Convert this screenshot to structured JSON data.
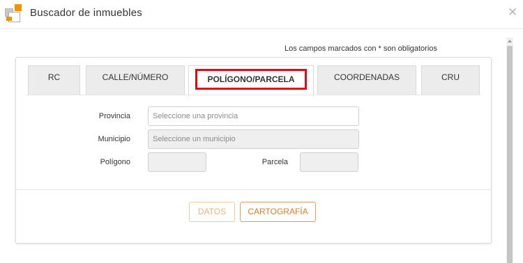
{
  "window": {
    "title": "Buscador de inmuebles",
    "close_symbol": "✕"
  },
  "form": {
    "required_note": "Los campos marcados con * son obligatorios"
  },
  "tabs": [
    {
      "label": "RC",
      "active": false
    },
    {
      "label": "CALLE/NÚMERO",
      "active": false
    },
    {
      "label": "POLÍGONO/PARCELA",
      "active": true
    },
    {
      "label": "COORDENADAS",
      "active": false
    },
    {
      "label": "CRU",
      "active": false
    }
  ],
  "fields": {
    "provincia": {
      "label": "Provincia",
      "placeholder": "Seleccione una provincia",
      "value": "",
      "enabled": true
    },
    "municipio": {
      "label": "Municipio",
      "placeholder": "Seleccione un municipio",
      "value": "",
      "enabled": false
    },
    "poligono": {
      "label": "Polígono",
      "value": "",
      "enabled": false
    },
    "parcela": {
      "label": "Parcela",
      "value": "",
      "enabled": false
    }
  },
  "buttons": {
    "datos": {
      "label": "DATOS",
      "enabled": false
    },
    "cartografia": {
      "label": "CARTOGRAFÍA",
      "enabled": true
    }
  },
  "colors": {
    "accent": "#f39200",
    "highlight_border": "#e30613",
    "button_text": "#e37a22"
  }
}
